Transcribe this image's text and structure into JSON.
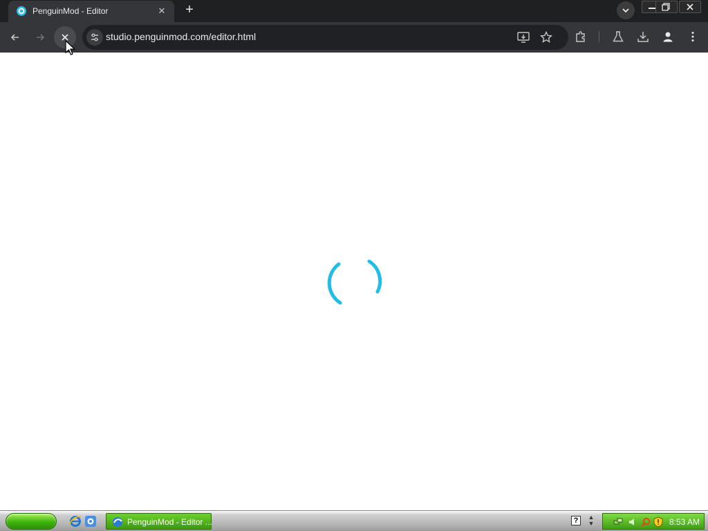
{
  "browser": {
    "tab": {
      "title": "PenguinMod - Editor",
      "favicon": "penguinmod-logo-icon"
    },
    "url": "studio.penguinmod.com/editor.html",
    "toolbar_icons": [
      "back-arrow-icon",
      "forward-arrow-icon",
      "stop-loading-icon",
      "site-info-icon",
      "install-app-icon",
      "bookmark-star-icon",
      "extensions-puzzle-icon",
      "labs-flask-icon",
      "download-icon",
      "profile-icon",
      "menu-kebab-icon"
    ]
  },
  "page": {
    "state": "loading",
    "spinner_color": "#1fbde8"
  },
  "taskbar": {
    "task_label": "PenguinMod - Editor ...",
    "clock": "8:53 AM",
    "help_glyph": "?",
    "accent": "#3f9e12"
  }
}
